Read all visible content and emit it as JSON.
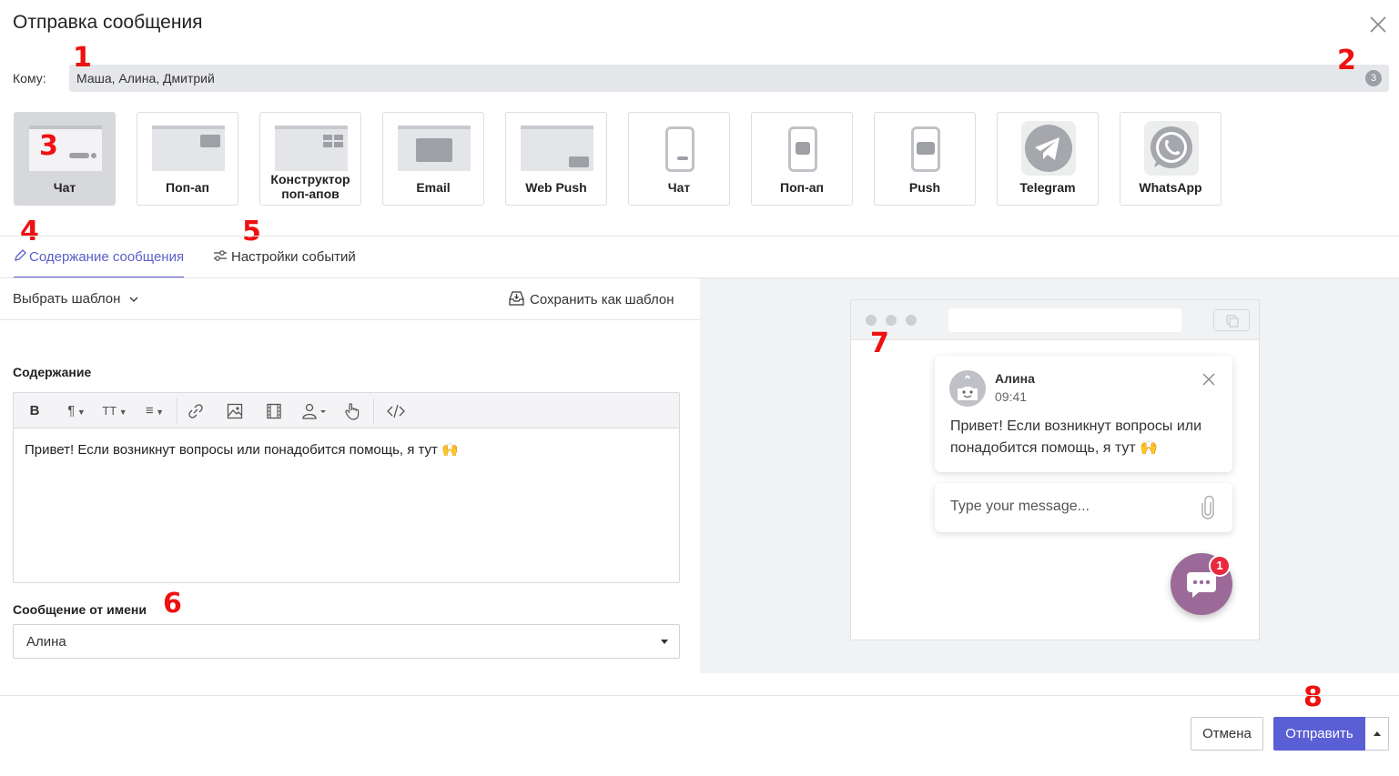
{
  "header": {
    "title": "Отправка сообщения"
  },
  "recipients": {
    "label": "Кому:",
    "value": "Маша, Алина, Дмитрий",
    "count": "3"
  },
  "markers": [
    "1",
    "2",
    "3",
    "4",
    "5",
    "6",
    "7",
    "8"
  ],
  "channels": [
    {
      "label": "Чат",
      "icon": "chat-widget-icon",
      "active": true
    },
    {
      "label": "Поп-ап",
      "icon": "popup-icon"
    },
    {
      "label": "Конструктор\nпоп-апов",
      "icon": "popup-builder-icon"
    },
    {
      "label": "Email",
      "icon": "email-icon"
    },
    {
      "label": "Web Push",
      "icon": "web-push-icon"
    },
    {
      "label": "Чат",
      "icon": "mobile-chat-icon"
    },
    {
      "label": "Поп-ап",
      "icon": "mobile-popup-icon"
    },
    {
      "label": "Push",
      "icon": "mobile-push-icon"
    },
    {
      "label": "Telegram",
      "icon": "telegram-icon"
    },
    {
      "label": "WhatsApp",
      "icon": "whatsapp-icon"
    }
  ],
  "tabs": [
    {
      "label": "Содержание сообщения",
      "icon": "pencil-icon",
      "active": true
    },
    {
      "label": "Настройки событий",
      "icon": "sliders-icon"
    }
  ],
  "template": {
    "choose": "Выбрать шаблон",
    "save": "Сохранить как шаблон"
  },
  "editor": {
    "label": "Содержание",
    "toolbar": [
      "B",
      "¶",
      "TT",
      "≡"
    ],
    "text": "Привет! Если возникнут вопросы или понадобится помощь, я тут 🙌"
  },
  "sender": {
    "label": "Сообщение от имени",
    "value": "Алина"
  },
  "preview": {
    "name": "Алина",
    "time": "09:41",
    "text": "Привет! Если возникнут вопросы или понадобится помощь, я тут 🙌",
    "input_placeholder": "Type your message...",
    "badge": "1"
  },
  "footer": {
    "cancel": "Отмена",
    "send": "Отправить"
  },
  "colors": {
    "accent": "#5b5fd6",
    "launcher": "#9b6a98",
    "badge": "#e8283e",
    "marker": "#e11111"
  }
}
